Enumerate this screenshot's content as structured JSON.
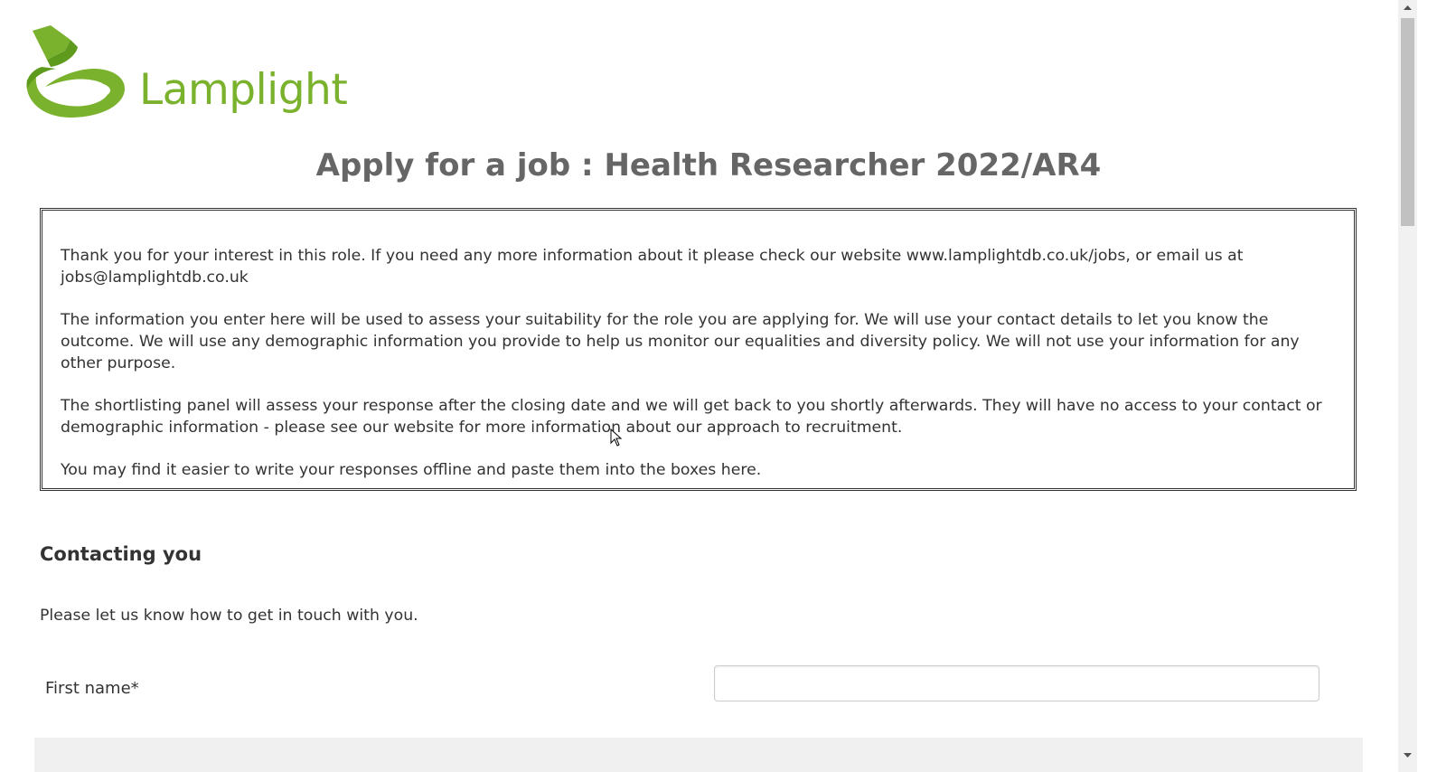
{
  "brand": {
    "name": "Lamplight",
    "logo_icon": "lamp-icon",
    "color": "#7ab22d"
  },
  "page_title": "Apply for a job : Health Researcher 2022/AR4",
  "intro": {
    "paragraphs": [
      "Thank you for your interest in this role.  If you need any more information about it please check our website www.lamplightdb.co.uk/jobs, or email us at jobs@lamplightdb.co.uk",
      "The information you enter here will be used to assess your suitability for the role you are applying for.  We will use your contact details to let you know the outcome.  We will use any demographic information you provide to help us monitor our equalities and diversity policy.  We will not use your information for any other purpose.",
      "The shortlisting panel will assess your response after the closing date and we will get back to you shortly afterwards.  They will have no access to your contact or demographic information - please see our website for more information about our approach to recruitment.",
      "You may find it easier to write your responses offline and paste them into the boxes here."
    ]
  },
  "contact_section": {
    "heading": "Contacting you",
    "description": "Please let us know how to get in touch with you.",
    "fields": [
      {
        "label": "First name*",
        "value": "",
        "placeholder": ""
      }
    ]
  }
}
